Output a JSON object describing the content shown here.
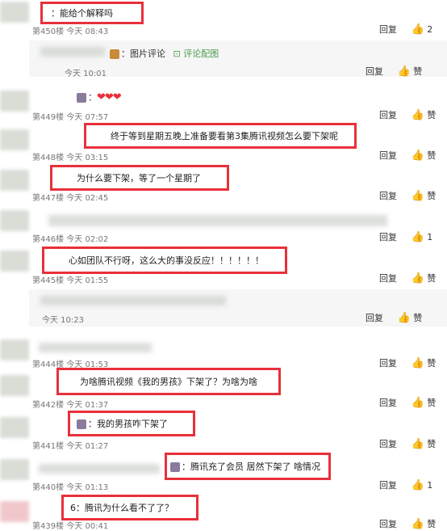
{
  "comments": [
    {
      "floor": "第450楼",
      "time": "今天 08:43",
      "text": "能给个解释吗",
      "likes": "2"
    },
    {
      "reply_time": "今天 10:01",
      "img_comment": "图片评论",
      "img_comment_link": "评论配图"
    },
    {
      "floor": "第449楼",
      "time": "今天 07:57"
    },
    {
      "floor": "第448楼",
      "time": "今天 03:15",
      "text": "终于等到星期五晚上准备要看第3集腾讯视频怎么要下架呢"
    },
    {
      "floor": "第447楼",
      "time": "今天 02:45",
      "text": "为什么要下架，等了一个星期了"
    },
    {
      "floor": "第446楼",
      "time": "今天 02:02",
      "likes": "1",
      "text": "心如团队不行呀，这么大的事没反应！！！！！！"
    },
    {
      "floor": "第445楼",
      "time": "今天 01:55"
    },
    {
      "reply_time": "今天 10:23"
    },
    {
      "floor": "第444楼",
      "time": "今天 01:53",
      "text": "为啥腾讯视频《我的男孩》下架了？为啥为啥"
    },
    {
      "floor": "第442楼",
      "time": "今天 01:37",
      "text": "我的男孩咋下架了"
    },
    {
      "floor": "第441楼",
      "time": "今天 01:27",
      "text": "腾讯充了会员 居然下架了 啥情况"
    },
    {
      "floor": "第440楼",
      "time": "今天 01:13",
      "likes": "1",
      "text": "腾讯为什么看不了了？"
    },
    {
      "floor": "第439楼",
      "time": "今天 00:41"
    }
  ],
  "ui": {
    "reply": "回复",
    "like": "赞",
    "colon": "：",
    "prefix6": "6",
    "thumb_icon": "thumbs-up-icon"
  }
}
